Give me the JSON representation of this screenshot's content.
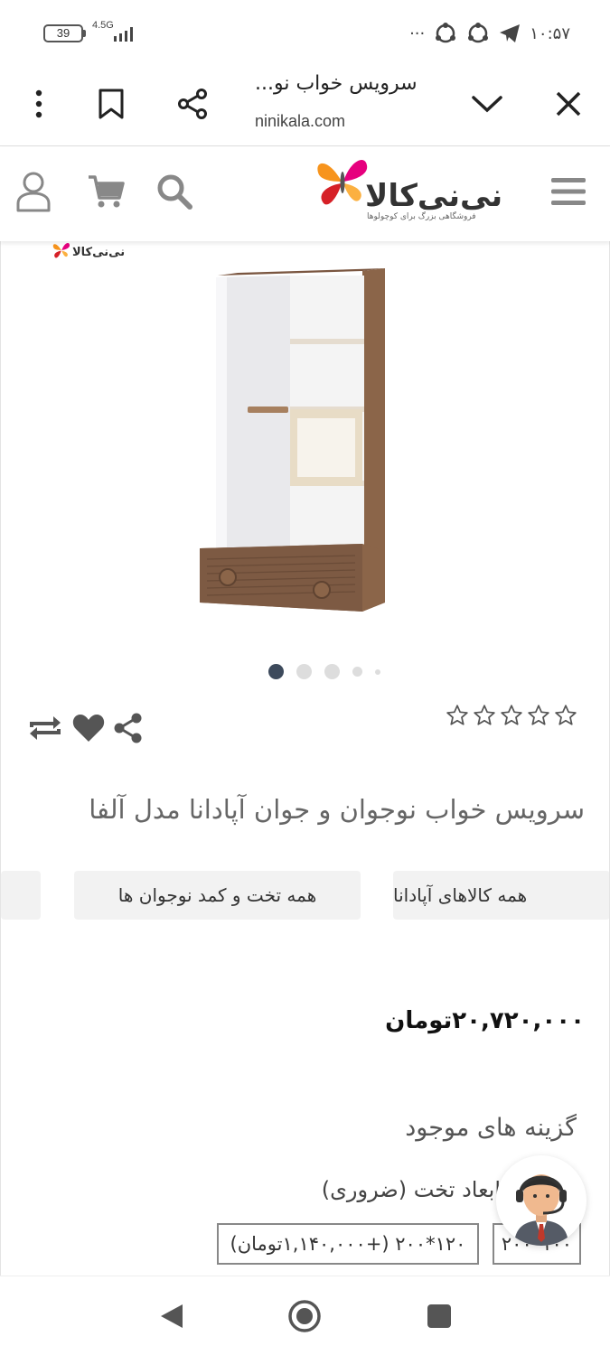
{
  "status_bar": {
    "battery": "39",
    "network": "4.5G",
    "time": "۱۰:۵۷",
    "more": "···"
  },
  "browser": {
    "title": "سرویس خواب نو...",
    "url": "ninikala.com"
  },
  "site": {
    "logo_text": "نی‌نی‌کالا",
    "logo_tagline": "فروشگاهی بزرگ برای کوچولوها",
    "watermark_text": "نی‌نی‌کالا"
  },
  "gallery": {
    "slide_count": 5,
    "active_slide": 1
  },
  "product": {
    "rating": 0,
    "rating_max": 5,
    "title": "سرویس خواب نوجوان و جوان آپادانا مدل آلفا",
    "categories": [
      "همه کالاهای آپادانا",
      "همه تخت و کمد نوجوان ها"
    ],
    "price": "۲۰,۷۲۰,۰۰۰تومان"
  },
  "options": {
    "title": "گزینه های موجود",
    "bed_dimensions_label": "ابعاد تخت (ضروری)",
    "bed_dimension_choices": [
      "۱۰۰*۲۰۰",
      "۱۲۰*۲۰۰ (+۱,۱۴۰,۰۰۰تومان)"
    ]
  },
  "colors": {
    "brand_orange": "#f7941d",
    "brand_pink": "#e6007e",
    "brand_red": "#d62027",
    "dot_active": "#3d4a5c",
    "wood": "#8b6549"
  }
}
